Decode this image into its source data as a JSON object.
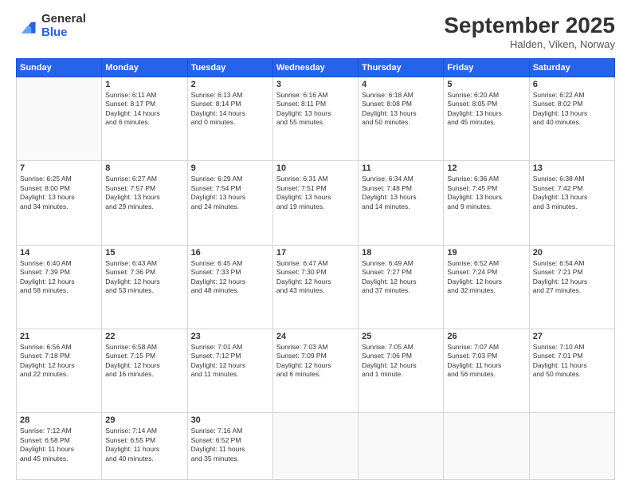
{
  "header": {
    "logo_general": "General",
    "logo_blue": "Blue",
    "month_title": "September 2025",
    "location": "Halden, Viken, Norway"
  },
  "days_of_week": [
    "Sunday",
    "Monday",
    "Tuesday",
    "Wednesday",
    "Thursday",
    "Friday",
    "Saturday"
  ],
  "weeks": [
    [
      {
        "day": "",
        "lines": []
      },
      {
        "day": "1",
        "lines": [
          "Sunrise: 6:11 AM",
          "Sunset: 8:17 PM",
          "Daylight: 14 hours",
          "and 6 minutes."
        ]
      },
      {
        "day": "2",
        "lines": [
          "Sunrise: 6:13 AM",
          "Sunset: 8:14 PM",
          "Daylight: 14 hours",
          "and 0 minutes."
        ]
      },
      {
        "day": "3",
        "lines": [
          "Sunrise: 6:16 AM",
          "Sunset: 8:11 PM",
          "Daylight: 13 hours",
          "and 55 minutes."
        ]
      },
      {
        "day": "4",
        "lines": [
          "Sunrise: 6:18 AM",
          "Sunset: 8:08 PM",
          "Daylight: 13 hours",
          "and 50 minutes."
        ]
      },
      {
        "day": "5",
        "lines": [
          "Sunrise: 6:20 AM",
          "Sunset: 8:05 PM",
          "Daylight: 13 hours",
          "and 45 minutes."
        ]
      },
      {
        "day": "6",
        "lines": [
          "Sunrise: 6:22 AM",
          "Sunset: 8:02 PM",
          "Daylight: 13 hours",
          "and 40 minutes."
        ]
      }
    ],
    [
      {
        "day": "7",
        "lines": [
          "Sunrise: 6:25 AM",
          "Sunset: 8:00 PM",
          "Daylight: 13 hours",
          "and 34 minutes."
        ]
      },
      {
        "day": "8",
        "lines": [
          "Sunrise: 6:27 AM",
          "Sunset: 7:57 PM",
          "Daylight: 13 hours",
          "and 29 minutes."
        ]
      },
      {
        "day": "9",
        "lines": [
          "Sunrise: 6:29 AM",
          "Sunset: 7:54 PM",
          "Daylight: 13 hours",
          "and 24 minutes."
        ]
      },
      {
        "day": "10",
        "lines": [
          "Sunrise: 6:31 AM",
          "Sunset: 7:51 PM",
          "Daylight: 13 hours",
          "and 19 minutes."
        ]
      },
      {
        "day": "11",
        "lines": [
          "Sunrise: 6:34 AM",
          "Sunset: 7:48 PM",
          "Daylight: 13 hours",
          "and 14 minutes."
        ]
      },
      {
        "day": "12",
        "lines": [
          "Sunrise: 6:36 AM",
          "Sunset: 7:45 PM",
          "Daylight: 13 hours",
          "and 9 minutes."
        ]
      },
      {
        "day": "13",
        "lines": [
          "Sunrise: 6:38 AM",
          "Sunset: 7:42 PM",
          "Daylight: 13 hours",
          "and 3 minutes."
        ]
      }
    ],
    [
      {
        "day": "14",
        "lines": [
          "Sunrise: 6:40 AM",
          "Sunset: 7:39 PM",
          "Daylight: 12 hours",
          "and 58 minutes."
        ]
      },
      {
        "day": "15",
        "lines": [
          "Sunrise: 6:43 AM",
          "Sunset: 7:36 PM",
          "Daylight: 12 hours",
          "and 53 minutes."
        ]
      },
      {
        "day": "16",
        "lines": [
          "Sunrise: 6:45 AM",
          "Sunset: 7:33 PM",
          "Daylight: 12 hours",
          "and 48 minutes."
        ]
      },
      {
        "day": "17",
        "lines": [
          "Sunrise: 6:47 AM",
          "Sunset: 7:30 PM",
          "Daylight: 12 hours",
          "and 43 minutes."
        ]
      },
      {
        "day": "18",
        "lines": [
          "Sunrise: 6:49 AM",
          "Sunset: 7:27 PM",
          "Daylight: 12 hours",
          "and 37 minutes."
        ]
      },
      {
        "day": "19",
        "lines": [
          "Sunrise: 6:52 AM",
          "Sunset: 7:24 PM",
          "Daylight: 12 hours",
          "and 32 minutes."
        ]
      },
      {
        "day": "20",
        "lines": [
          "Sunrise: 6:54 AM",
          "Sunset: 7:21 PM",
          "Daylight: 12 hours",
          "and 27 minutes."
        ]
      }
    ],
    [
      {
        "day": "21",
        "lines": [
          "Sunrise: 6:56 AM",
          "Sunset: 7:18 PM",
          "Daylight: 12 hours",
          "and 22 minutes."
        ]
      },
      {
        "day": "22",
        "lines": [
          "Sunrise: 6:58 AM",
          "Sunset: 7:15 PM",
          "Daylight: 12 hours",
          "and 16 minutes."
        ]
      },
      {
        "day": "23",
        "lines": [
          "Sunrise: 7:01 AM",
          "Sunset: 7:12 PM",
          "Daylight: 12 hours",
          "and 11 minutes."
        ]
      },
      {
        "day": "24",
        "lines": [
          "Sunrise: 7:03 AM",
          "Sunset: 7:09 PM",
          "Daylight: 12 hours",
          "and 6 minutes."
        ]
      },
      {
        "day": "25",
        "lines": [
          "Sunrise: 7:05 AM",
          "Sunset: 7:06 PM",
          "Daylight: 12 hours",
          "and 1 minute."
        ]
      },
      {
        "day": "26",
        "lines": [
          "Sunrise: 7:07 AM",
          "Sunset: 7:03 PM",
          "Daylight: 11 hours",
          "and 56 minutes."
        ]
      },
      {
        "day": "27",
        "lines": [
          "Sunrise: 7:10 AM",
          "Sunset: 7:01 PM",
          "Daylight: 11 hours",
          "and 50 minutes."
        ]
      }
    ],
    [
      {
        "day": "28",
        "lines": [
          "Sunrise: 7:12 AM",
          "Sunset: 6:58 PM",
          "Daylight: 11 hours",
          "and 45 minutes."
        ]
      },
      {
        "day": "29",
        "lines": [
          "Sunrise: 7:14 AM",
          "Sunset: 6:55 PM",
          "Daylight: 11 hours",
          "and 40 minutes."
        ]
      },
      {
        "day": "30",
        "lines": [
          "Sunrise: 7:16 AM",
          "Sunset: 6:52 PM",
          "Daylight: 11 hours",
          "and 35 minutes."
        ]
      },
      {
        "day": "",
        "lines": []
      },
      {
        "day": "",
        "lines": []
      },
      {
        "day": "",
        "lines": []
      },
      {
        "day": "",
        "lines": []
      }
    ]
  ]
}
